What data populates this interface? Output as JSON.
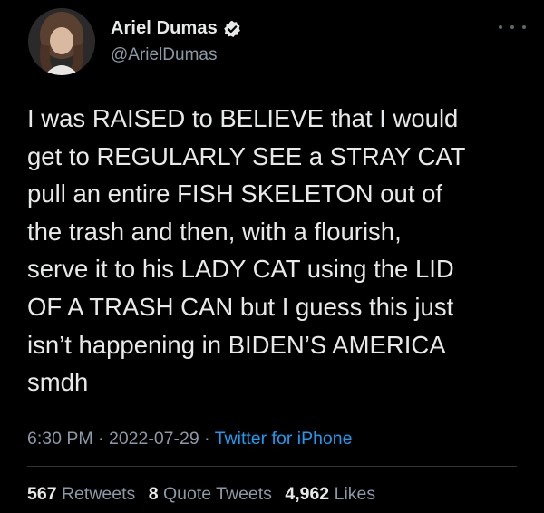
{
  "author": {
    "display_name": "Ariel Dumas",
    "handle": "@ArielDumas",
    "verified": true,
    "avatar_icon": "profile-photo"
  },
  "menu_icon": "more-horizontal-icon",
  "tweet": {
    "text": "I was RAISED to BELIEVE that I would\nget to REGULARLY SEE a STRAY CAT\npull an entire FISH SKELETON out of\nthe trash and then, with a flourish,\nserve it to his LADY CAT using the LID\nOF A TRASH CAN but I guess this just\nisn’t happening in BIDEN’S AMERICA\nsmdh"
  },
  "meta": {
    "time": "6:30 PM",
    "separator": "·",
    "date": "2022-07-29",
    "source": "Twitter for iPhone"
  },
  "stats": {
    "retweets_count": "567",
    "retweets_label": "Retweets",
    "quotes_count": "8",
    "quotes_label": "Quote Tweets",
    "likes_count": "4,962",
    "likes_label": "Likes"
  },
  "colors": {
    "background": "#000000",
    "text": "#e7e9ea",
    "secondary": "#8b98a5",
    "link": "#1d9bf0",
    "divider": "#2f3336"
  }
}
